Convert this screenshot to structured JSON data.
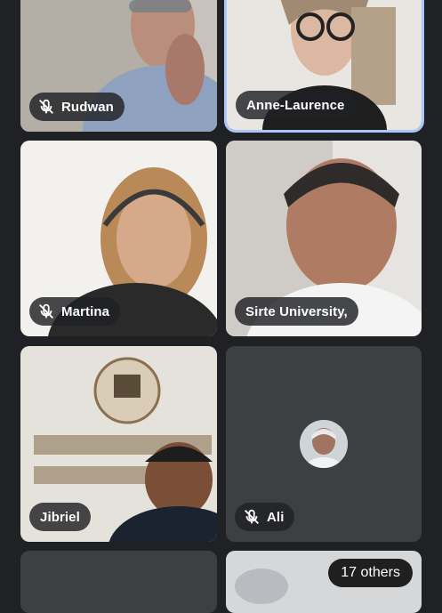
{
  "participants": [
    {
      "name": "Rudwan",
      "muted": true
    },
    {
      "name": "Anne-Laurence",
      "muted": false,
      "active_speaker": true
    },
    {
      "name": "Martina",
      "muted": true
    },
    {
      "name": "Sirte University,",
      "muted": false
    },
    {
      "name": "Jibriel",
      "muted": false
    },
    {
      "name": "Ali",
      "muted": true
    },
    {
      "name": "",
      "muted": false
    },
    {
      "name": "",
      "muted": false
    }
  ],
  "others_label": "17 others",
  "icons": {
    "muted": "mic-off-icon"
  },
  "colors": {
    "background": "#202124",
    "tile": "#3c4043",
    "active_border": "#a8c7fa",
    "chip": "#202124"
  }
}
